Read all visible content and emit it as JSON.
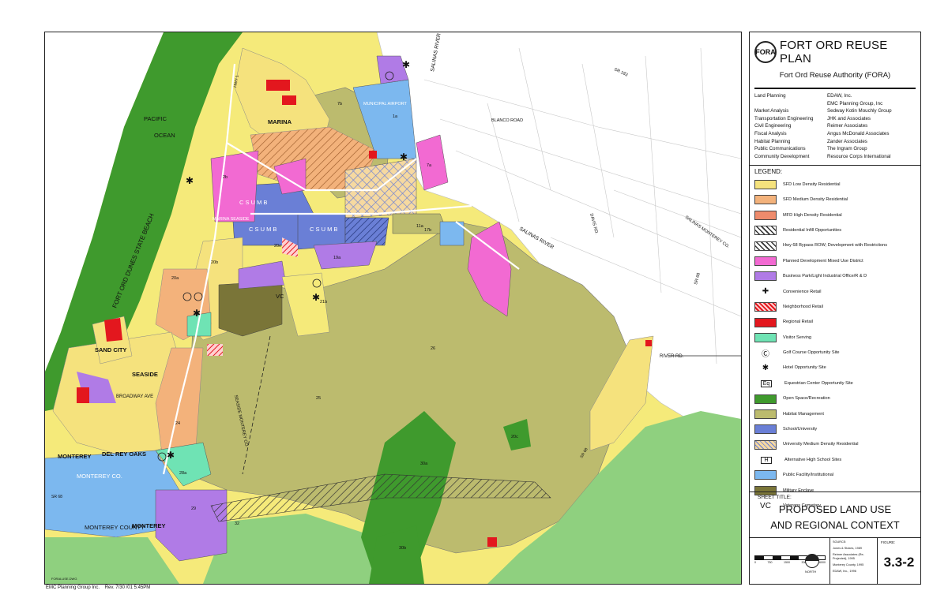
{
  "map": {
    "labels": {
      "pacific": "PACIFIC",
      "ocean": "OCEAN",
      "fort_ord_dunes": "FORT ORD DUNES STATE BEACH",
      "marina": "MARINA",
      "csumb1": "C S U M B",
      "csumb2": "C S U M B",
      "csumb3": "C S U M B",
      "marina_seaside": "MARINA SEASIDE",
      "sand_city": "SAND CITY",
      "seaside": "SEASIDE",
      "broadway": "BROADWAY AVE",
      "monterey": "MONTEREY",
      "del_rey_oaks": "DEL REY OAKS",
      "monterey_co": "MONTEREY CO.",
      "monterey_county": "MONTEREY COUNTY",
      "monterey2": "MONTEREY",
      "municipal_airport": "MUNICIPAL AIRPORT",
      "blanco_road": "BLANCO ROAD",
      "salinas_river_n": "SALINAS RIVER",
      "salinas_river_e": "SALINAS RIVER",
      "river_rd": "RIVER RD.",
      "davis_rd": "DAVIS RD.",
      "sr183": "SR 183",
      "sr68_e": "SR 68",
      "salinas_monterey": "SALINAS MONTEREY CO.",
      "seaside_monterey": "SEASIDE MONTEREY CO.",
      "vc": "VC",
      "hwy1": "HWY 1",
      "sr68_s": "SR 68",
      "p25": "25",
      "p2b": "2b",
      "p11a": "11a",
      "p17b": "17b",
      "p21b": "21b",
      "p20c": "20c",
      "p7a": "7a",
      "p7b": "7b",
      "p1a": "1a",
      "p24": "24",
      "p32": "32",
      "p30a": "30a",
      "p30b": "30b",
      "p26": "26",
      "p19a": "19a",
      "p20a": "20a",
      "p20b": "20b",
      "p20e": "20e",
      "p28a": "28a",
      "p29": "29",
      "dwg": "FORALUSE.DWG"
    }
  },
  "footer_left": {
    "company": "EMC Planning Group Inc.",
    "rev": "Rev.   7/30 /01 5:45PM"
  },
  "panel": {
    "logo": "FORA",
    "title": "FORT ORD REUSE PLAN",
    "authority": "Fort Ord Reuse Authority (FORA)",
    "credits": [
      {
        "role": "Land Planning",
        "firm": "EDAW, Inc."
      },
      {
        "role": "",
        "firm": "EMC Planning Group, Inc"
      },
      {
        "role": "Market Analysis",
        "firm": "Sedway Kotin Mouchly Group"
      },
      {
        "role": "Transportation Engineering",
        "firm": "JHK and Associates"
      },
      {
        "role": "Civil Engineering",
        "firm": "Reimer Associates"
      },
      {
        "role": "Fiscal Analysis",
        "firm": "Angus McDonald  Associates"
      },
      {
        "role": "Habitat Planning",
        "firm": "Zander Associates"
      },
      {
        "role": "Public Communications",
        "firm": "The Ingram Group"
      },
      {
        "role": "Community Development",
        "firm": "Resource Corps International"
      }
    ],
    "legend_title": "LEGEND:",
    "legend": [
      {
        "kind": "swatch",
        "color": "#f5e27d",
        "label": "SFD Low Density Residential"
      },
      {
        "kind": "swatch",
        "color": "#f3b27b",
        "label": "SFD Medium Density Residential"
      },
      {
        "kind": "swatch",
        "color": "#ee8b6c",
        "label": "MFD High Density Residential"
      },
      {
        "kind": "hatch",
        "color": "#ffffff",
        "label": "Residential Infill Opportunities"
      },
      {
        "kind": "hatch",
        "color": "#ffffff",
        "label": "Hwy 68 Bypass ROW; Development with Restrictions"
      },
      {
        "kind": "swatch",
        "color": "#f26ad2",
        "label": "Planned Development Mixed Use District"
      },
      {
        "kind": "swatch",
        "color": "#b07be6",
        "label": "Business Park/Light Industrial Office/R & D"
      },
      {
        "kind": "symbol",
        "symbol": "✚",
        "label": "Convenience Retail"
      },
      {
        "kind": "redhatch",
        "color": "#e8363b",
        "label": "Neighborhood Retail"
      },
      {
        "kind": "swatch",
        "color": "#e3171e",
        "label": "Regional Retail"
      },
      {
        "kind": "swatch",
        "color": "#6fe3b4",
        "label": "Visitor Serving"
      },
      {
        "kind": "symbol",
        "symbol": "Ⓒ",
        "label": "Golf Course Opportunity Site"
      },
      {
        "kind": "symbol",
        "symbol": "✱",
        "label": "Hotel Opportunity Site"
      },
      {
        "kind": "symbol",
        "symbol": "Eq",
        "label": "Equestrian Center Opportunity Site"
      },
      {
        "kind": "swatch",
        "color": "#3f9a2d",
        "label": "Open Space/Recreation"
      },
      {
        "kind": "swatch",
        "color": "#bcbb6e",
        "label": "Habitat Management"
      },
      {
        "kind": "swatch",
        "color": "#6a7fd6",
        "label": "School/University"
      },
      {
        "kind": "plaid",
        "color": "#f6d9a0",
        "label": "University Medium Density Residential"
      },
      {
        "kind": "symbol",
        "symbol": "H",
        "label": "Alternative High School Sites"
      },
      {
        "kind": "swatch",
        "color": "#7cb8ef",
        "label": "Public Facility/Institutional"
      },
      {
        "kind": "swatch",
        "color": "#7a7538",
        "label": "Military Enclave"
      },
      {
        "kind": "symbol",
        "symbol": "VC",
        "label": "Veterans Cemetary"
      }
    ],
    "sheet_label": "SHEET TITLE:",
    "sheet_title_1": "PROPOSED LAND USE",
    "sheet_title_2": "AND REGIONAL CONTEXT",
    "source_label": "SOURCE:",
    "sources": [
      "Jones & Stokes, 1989",
      "Reimer Associates (Re-Projected), 1995",
      "Monterey County, 1995",
      "EDAW, Inc., 1996"
    ],
    "north": "NORTH",
    "scale_ticks": [
      "0",
      "750",
      "1500",
      "3000",
      "6000"
    ],
    "figure_label": "FIGURE:",
    "figure_number": "3.3-2"
  }
}
